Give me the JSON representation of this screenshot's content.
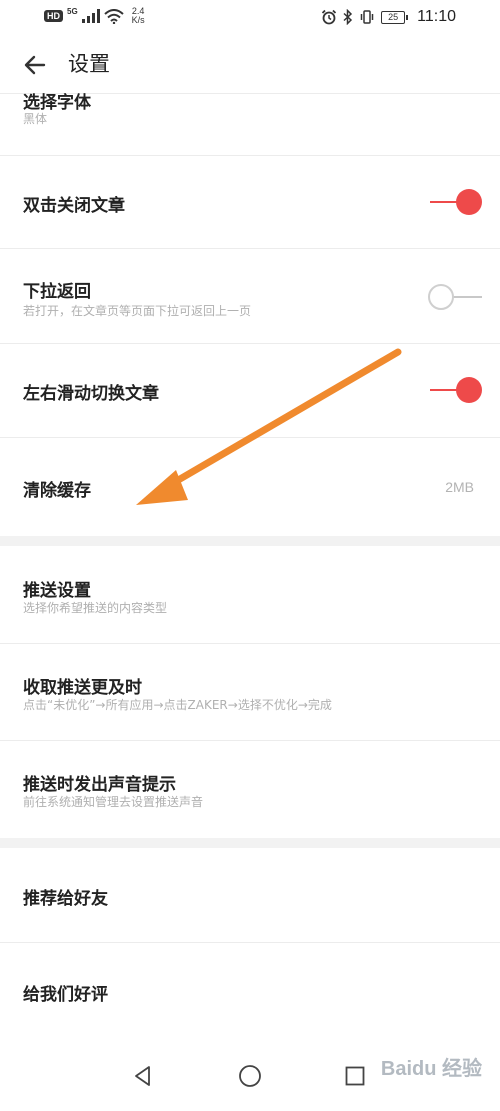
{
  "status_bar": {
    "hd": "HD",
    "network_type": "5G",
    "speed_value": "2.4",
    "speed_unit": "K/s",
    "battery": "25",
    "time": "11:10"
  },
  "header": {
    "title": "设置"
  },
  "rows": {
    "font": {
      "title": "选择字体",
      "subtitle": "黑体"
    },
    "double_tap_close": {
      "title": "双击关闭文章",
      "toggle": "on"
    },
    "pull_back": {
      "title": "下拉返回",
      "subtitle": "若打开，在文章页等页面下拉可返回上一页",
      "toggle": "off"
    },
    "swipe_switch": {
      "title": "左右滑动切换文章",
      "toggle": "on"
    },
    "clear_cache": {
      "title": "清除缓存",
      "value": "2MB"
    },
    "push_settings": {
      "title": "推送设置",
      "subtitle": "选择你希望推送的内容类型"
    },
    "push_timely": {
      "title": "收取推送更及时",
      "subtitle": "点击“未优化”→所有应用→点击ZAKER→选择不优化→完成"
    },
    "push_sound": {
      "title": "推送时发出声音提示",
      "subtitle": "前往系统通知管理去设置推送声音"
    },
    "recommend_friend": {
      "title": "推荐给好友"
    },
    "rate_us": {
      "title": "给我们好评"
    }
  },
  "watermark": "Baidu 经验",
  "colors": {
    "accent": "#ee4a4a",
    "annotation_arrow": "#f08a2e",
    "divider": "#ececec",
    "section_gap": "#f2f2f2"
  },
  "icons": {
    "back": "arrow-left-icon",
    "nav_back": "triangle-back-icon",
    "nav_home": "circle-home-icon",
    "nav_recent": "square-recent-icon"
  }
}
